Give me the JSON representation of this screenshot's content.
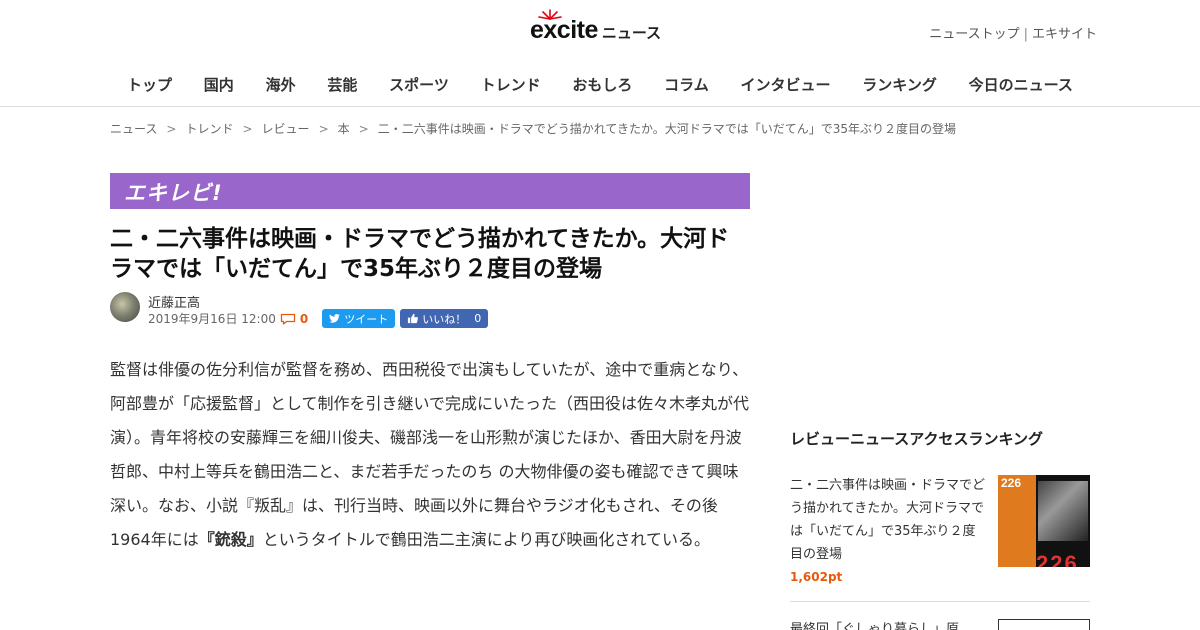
{
  "header": {
    "logo": {
      "brand": "excite",
      "suffix": "ニュース"
    },
    "top_links": [
      "ニューストップ",
      "エキサイト"
    ],
    "top_links_separator": "|",
    "nav": [
      "トップ",
      "国内",
      "海外",
      "芸能",
      "スポーツ",
      "トレンド",
      "おもしろ",
      "コラム",
      "インタビュー",
      "ランキング",
      "今日のニュース"
    ]
  },
  "breadcrumb": {
    "separator": ">",
    "items": [
      "ニュース",
      "トレンド",
      "レビュー",
      "本",
      "二・二六事件は映画・ドラマでどう描かれてきたか。大河ドラマでは「いだてん」で35年ぶり２度目の登場"
    ]
  },
  "banner": {
    "label": "エキレビ!",
    "color": "#9966cc"
  },
  "article": {
    "title": "二・二六事件は映画・ドラマでどう描かれてきたか。大河ドラマでは「いだてん」で35年ぶり２度目の登場",
    "author": "近藤正高",
    "date": "2019年9月16日 12:00",
    "comment_count": "0",
    "tweet_label": "ツイート",
    "like_label": "いいね！",
    "like_count": "0",
    "body_part1": "監督は俳優の佐分利信が監督を務め、西田税役で出演もしていたが、途中で重病となり、阿部豊が「応援監督」として制作を引き継いで完成にいたった（西田役は佐々木孝丸が代演）。青年将校の安藤輝三を細川俊夫、磯部浅一を山形勲が演じたほか、香田大尉を丹波哲郎、中村上等兵を鶴田浩二と、まだ若手だったのち の大物俳優の姿も確認できて興味深い。なお、小説『叛乱』は、刊行当時、映画以外に舞台やラジオ化もされ、その後1964年には",
    "body_bold": "『銃殺』",
    "body_part2": "というタイトルで鶴田浩二主演により再び映画化されている。"
  },
  "sidebar": {
    "heading": "レビューニュースアクセスランキング",
    "items": [
      {
        "title": "二・二六事件は映画・ドラマでどう描かれてきたか。大河ドラマでは「いだてん」で35年ぶり２度目の登場",
        "points": "1,602pt",
        "thumb_text": "226",
        "thumb_big": "226"
      },
      {
        "title": "最終回「ぐしゃり暮らし」原"
      }
    ]
  },
  "colors": {
    "accent_orange": "#e8590c",
    "twitter_blue": "#1d9bf0",
    "facebook_blue": "#4267b2",
    "banner_purple": "#9966cc"
  }
}
